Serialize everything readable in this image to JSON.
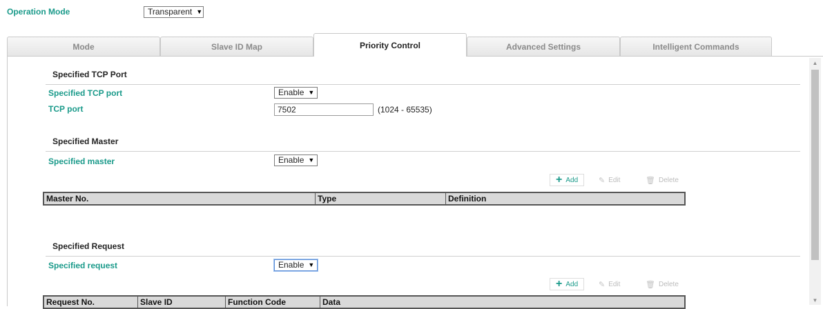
{
  "operation_mode": {
    "label": "Operation Mode",
    "value": "Transparent"
  },
  "tabs": [
    {
      "label": "Mode"
    },
    {
      "label": "Slave ID Map"
    },
    {
      "label": "Priority Control"
    },
    {
      "label": "Advanced Settings"
    },
    {
      "label": "Intelligent Commands"
    }
  ],
  "active_tab": "Priority Control",
  "tcp_section": {
    "title": "Specified TCP Port",
    "enable_label": "Specified TCP port",
    "enable_value": "Enable",
    "port_label": "TCP port",
    "port_value": "7502",
    "port_range": "(1024 - 65535)"
  },
  "master_section": {
    "title": "Specified Master",
    "enable_label": "Specified master",
    "enable_value": "Enable",
    "actions": {
      "add": "Add",
      "edit": "Edit",
      "delete": "Delete"
    },
    "columns": [
      "Master No.",
      "Type",
      "Definition"
    ]
  },
  "request_section": {
    "title": "Specified Request",
    "enable_label": "Specified request",
    "enable_value": "Enable",
    "actions": {
      "add": "Add",
      "edit": "Edit",
      "delete": "Delete"
    },
    "columns": [
      "Request No.",
      "Slave ID",
      "Function Code",
      "Data"
    ]
  },
  "colors": {
    "accent": "#1a9a8a",
    "tab_border": "#c9c9c9",
    "grid_header": "#d9d9d9"
  }
}
